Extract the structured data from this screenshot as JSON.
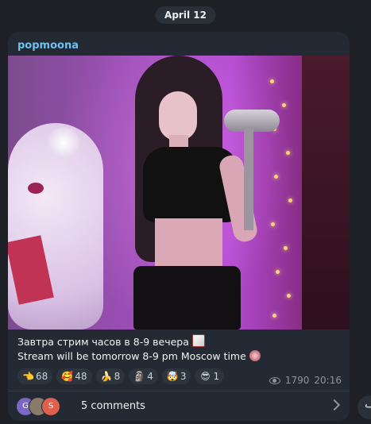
{
  "date_pill": "April 12",
  "post": {
    "channel_name": "popmoona",
    "caption_line1": "Завтра стрим часов в 8-9 вечера",
    "caption_line2": "Stream will be tomorrow 8-9 pm Moscow time",
    "reactions": [
      {
        "emoji": "👈",
        "count": "68"
      },
      {
        "emoji": "🥰",
        "count": "48"
      },
      {
        "emoji": "🍌",
        "count": "8"
      },
      {
        "emoji": "🗿",
        "count": "4"
      },
      {
        "emoji": "🤯",
        "count": "3"
      },
      {
        "emoji": "😎",
        "count": "1"
      }
    ],
    "views": "1790",
    "time": "20:16",
    "comments": {
      "label": "5 comments",
      "avatars": [
        {
          "letter": "G",
          "color": "#7b68c4"
        },
        {
          "letter": "",
          "color": "#8a7a6a"
        },
        {
          "letter": "S",
          "color": "#e0604f"
        }
      ]
    }
  },
  "forward_icon": "↪"
}
